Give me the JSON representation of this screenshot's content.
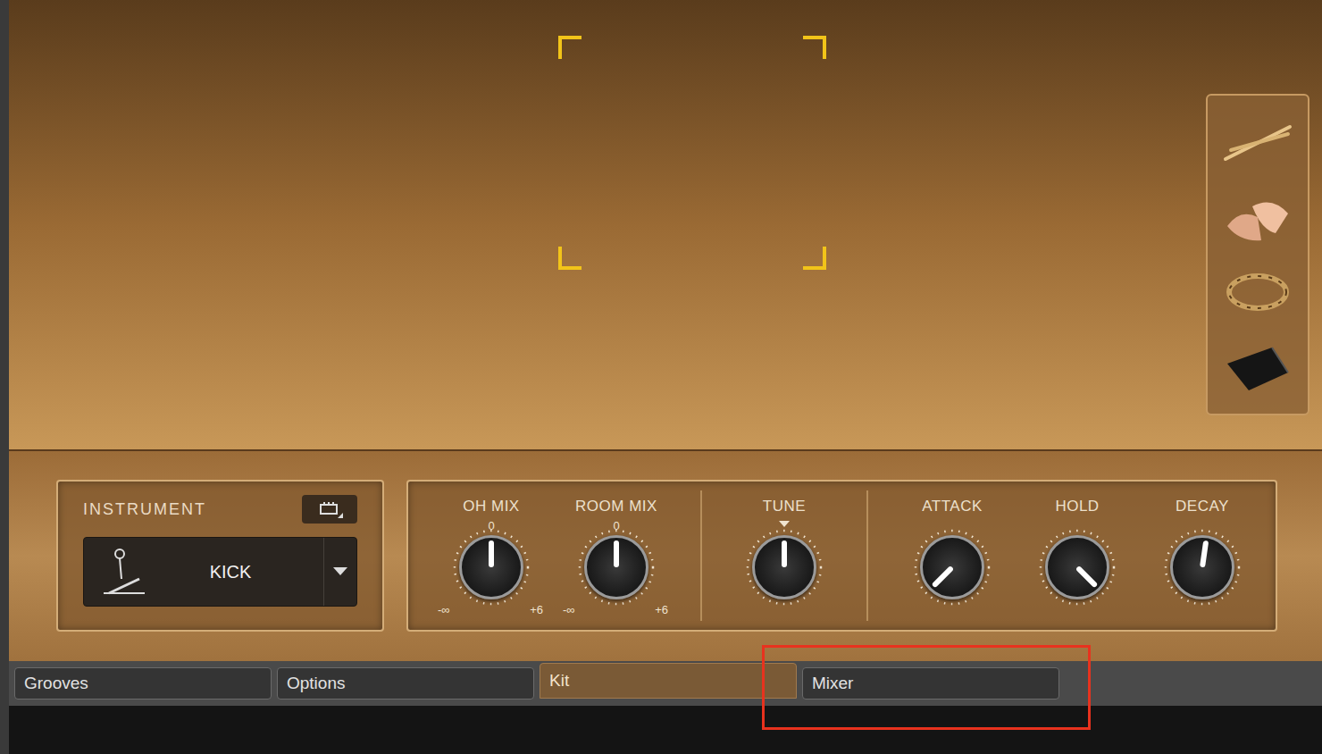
{
  "instrument": {
    "label": "INSTRUMENT",
    "value": "KICK"
  },
  "knob_groups": [
    {
      "knobs": [
        {
          "label": "OH MIX",
          "kind": "scale",
          "level": 0.5,
          "min": "-∞",
          "max": "+6",
          "center": "0"
        },
        {
          "label": "ROOM MIX",
          "kind": "scale",
          "level": 0.5,
          "min": "-∞",
          "max": "+6",
          "center": "0"
        }
      ]
    },
    {
      "knobs": [
        {
          "label": "TUNE",
          "kind": "marker",
          "level": 0.5
        }
      ]
    },
    {
      "knobs": [
        {
          "label": "ATTACK",
          "kind": "plain",
          "level": 0.0
        },
        {
          "label": "HOLD",
          "kind": "plain",
          "level": 1.0
        },
        {
          "label": "DECAY",
          "kind": "plain",
          "level": 0.53
        }
      ]
    }
  ],
  "articulations": [
    {
      "kind": "sticks"
    },
    {
      "kind": "brushes"
    },
    {
      "kind": "tambourine"
    },
    {
      "kind": "cowbell"
    }
  ],
  "tabs": [
    {
      "label": "Grooves",
      "selected": false
    },
    {
      "label": "Options",
      "selected": false
    },
    {
      "label": "Kit",
      "selected": true
    },
    {
      "label": "Mixer",
      "selected": false
    }
  ]
}
